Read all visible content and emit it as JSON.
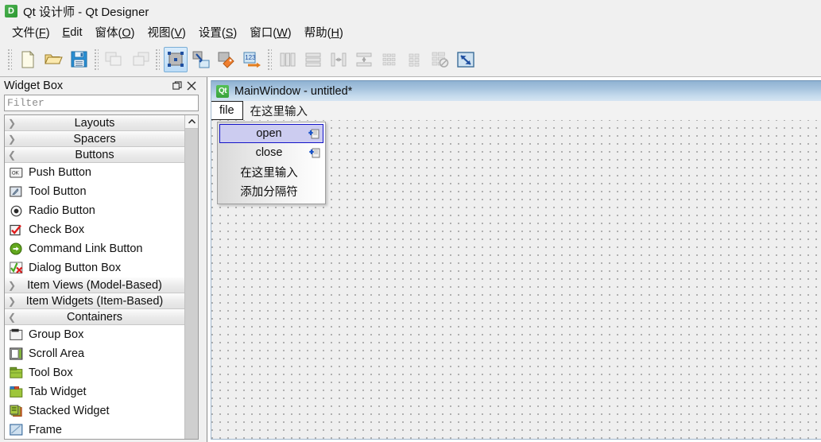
{
  "window": {
    "title": "Qt 设计师 - Qt Designer",
    "app_icon": "D"
  },
  "menubar": {
    "items": [
      {
        "label": "文件(F)",
        "mnemonic": "F"
      },
      {
        "label": "Edit",
        "mnemonic": "E"
      },
      {
        "label": "窗体(O)",
        "mnemonic": "O"
      },
      {
        "label": "视图(V)",
        "mnemonic": "V"
      },
      {
        "label": "设置(S)",
        "mnemonic": "S"
      },
      {
        "label": "窗口(W)",
        "mnemonic": "W"
      },
      {
        "label": "帮助(H)",
        "mnemonic": "H"
      }
    ]
  },
  "toolbar": {
    "groups": [
      {
        "buttons": [
          {
            "name": "new-form-icon",
            "label": "New",
            "state": "enabled"
          },
          {
            "name": "open-form-icon",
            "label": "Open",
            "state": "enabled"
          },
          {
            "name": "save-form-icon",
            "label": "Save",
            "state": "enabled"
          }
        ]
      },
      {
        "buttons": [
          {
            "name": "undo-icon",
            "label": "Undo",
            "state": "disabled"
          },
          {
            "name": "redo-icon",
            "label": "Redo",
            "state": "disabled"
          }
        ]
      },
      {
        "buttons": [
          {
            "name": "edit-widgets-icon",
            "label": "Edit Widgets",
            "state": "active"
          },
          {
            "name": "edit-signals-slots-icon",
            "label": "Edit Signals/Slots",
            "state": "enabled"
          },
          {
            "name": "edit-buddies-icon",
            "label": "Edit Buddies",
            "state": "enabled"
          },
          {
            "name": "edit-tab-order-icon",
            "label": "Edit Tab Order",
            "state": "enabled"
          }
        ]
      },
      {
        "buttons": [
          {
            "name": "layout-horizontally-icon",
            "label": "Lay Out Horizontally",
            "state": "disabled"
          },
          {
            "name": "layout-vertically-icon",
            "label": "Lay Out Vertically",
            "state": "disabled"
          },
          {
            "name": "layout-splitter-horizontal-icon",
            "label": "Lay Out Horizontally in Splitter",
            "state": "disabled"
          },
          {
            "name": "layout-splitter-vertical-icon",
            "label": "Lay Out Vertically in Splitter",
            "state": "disabled"
          },
          {
            "name": "layout-form-icon",
            "label": "Lay Out in a Form Layout",
            "state": "disabled"
          },
          {
            "name": "layout-grid-icon",
            "label": "Lay Out in a Grid",
            "state": "disabled"
          },
          {
            "name": "break-layout-icon",
            "label": "Break Layout",
            "state": "disabled"
          },
          {
            "name": "adjust-size-icon",
            "label": "Adjust Size",
            "state": "enabled"
          }
        ]
      }
    ]
  },
  "widget_box": {
    "title": "Widget Box",
    "float_button": "float-icon",
    "close_button": "close-icon",
    "filter_placeholder": "Filter",
    "filter_value": "",
    "scroll": {
      "up_arrow": "▲"
    },
    "entries": [
      {
        "type": "category",
        "label": "Layouts",
        "expanded": false
      },
      {
        "type": "category",
        "label": "Spacers",
        "expanded": false
      },
      {
        "type": "category",
        "label": "Buttons",
        "expanded": true
      },
      {
        "type": "item",
        "label": "Push Button",
        "icon": "push-button-icon"
      },
      {
        "type": "item",
        "label": "Tool Button",
        "icon": "tool-button-icon"
      },
      {
        "type": "item",
        "label": "Radio Button",
        "icon": "radio-button-icon"
      },
      {
        "type": "item",
        "label": "Check Box",
        "icon": "check-box-icon"
      },
      {
        "type": "item",
        "label": "Command Link Button",
        "icon": "command-link-button-icon"
      },
      {
        "type": "item",
        "label": "Dialog Button Box",
        "icon": "dialog-button-box-icon"
      },
      {
        "type": "category",
        "label": "Item Views (Model-Based)",
        "expanded": false
      },
      {
        "type": "category",
        "label": "Item Widgets (Item-Based)",
        "expanded": false
      },
      {
        "type": "category",
        "label": "Containers",
        "expanded": true
      },
      {
        "type": "item",
        "label": "Group Box",
        "icon": "group-box-icon"
      },
      {
        "type": "item",
        "label": "Scroll Area",
        "icon": "scroll-area-icon"
      },
      {
        "type": "item",
        "label": "Tool Box",
        "icon": "tool-box-icon"
      },
      {
        "type": "item",
        "label": "Tab Widget",
        "icon": "tab-widget-icon"
      },
      {
        "type": "item",
        "label": "Stacked Widget",
        "icon": "stacked-widget-icon"
      },
      {
        "type": "item",
        "label": "Frame",
        "icon": "frame-icon"
      }
    ]
  },
  "form_editor": {
    "main_window": {
      "title": "MainWindow - untitled*",
      "icon_text": "Qt",
      "menubar": {
        "menus": [
          {
            "label": "file",
            "selected": true
          },
          {
            "label": "在这里输入",
            "selected": false
          }
        ]
      }
    },
    "dropdown": {
      "items": [
        {
          "label": "open",
          "selected": true,
          "badge": "shortcut-badge-icon"
        },
        {
          "label": "close",
          "selected": false,
          "badge": "shortcut-badge-icon"
        },
        {
          "label": "在这里输入",
          "selected": false,
          "badge": null
        },
        {
          "label": "添加分隔符",
          "selected": false,
          "badge": null
        }
      ]
    }
  },
  "colors": {
    "window_bg": "#f0f0f0",
    "toolbar_active": "#bcdcf7",
    "mw_titlebar_blue": "#a7c4de",
    "menu_selection_fill": "#ccccf0",
    "menu_selection_border": "#1414c8",
    "canvas_bg": "#efefef",
    "grid_dot": "#9e9e9e"
  }
}
